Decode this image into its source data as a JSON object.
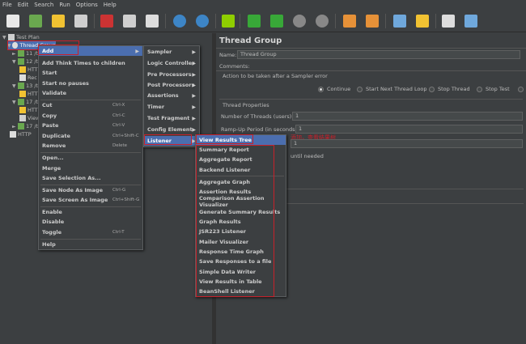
{
  "menubar": [
    "File",
    "Edit",
    "Search",
    "Run",
    "Options",
    "Help"
  ],
  "tree": {
    "test_plan": "Test Plan",
    "thread_group": "Thread Group",
    "items": [
      "11 /ti",
      "12 /ti",
      "HTT",
      "Rec",
      "13 /ti",
      "HTT",
      "17 /ti",
      "HTT",
      "View",
      "17 /ti",
      "HTTP"
    ]
  },
  "right_panel": {
    "title": "Thread Group",
    "name_label": "Name:",
    "name_value": "Thread Group",
    "comments_label": "Comments:",
    "error_section": "Action to be taken after a Sampler error",
    "error_options": [
      "Continue",
      "Start Next Thread Loop",
      "Stop Thread",
      "Stop Test",
      "S"
    ],
    "selected_error_option": "Continue",
    "thread_props": "Thread Properties",
    "threads_label": "Number of Threads (users):",
    "threads_value": "1",
    "rampup_label": "Ramp-Up Period (in seconds):",
    "rampup_value": "1",
    "loop_value": "1",
    "until_needed": "until needed",
    "chinese_note": "添加，查看结果树"
  },
  "context_menu": {
    "items": [
      {
        "label": "Add",
        "shortcut": ""
      },
      {
        "label": "Add Think Times to children",
        "shortcut": ""
      },
      {
        "label": "Start",
        "shortcut": ""
      },
      {
        "label": "Start no pauses",
        "shortcut": ""
      },
      {
        "label": "Validate",
        "shortcut": ""
      },
      {
        "label": "Cut",
        "shortcut": "Ctrl-X"
      },
      {
        "label": "Copy",
        "shortcut": "Ctrl-C"
      },
      {
        "label": "Paste",
        "shortcut": "Ctrl-V"
      },
      {
        "label": "Duplicate",
        "shortcut": "Ctrl+Shift-C"
      },
      {
        "label": "Remove",
        "shortcut": "Delete"
      },
      {
        "label": "Open...",
        "shortcut": ""
      },
      {
        "label": "Merge",
        "shortcut": ""
      },
      {
        "label": "Save Selection As...",
        "shortcut": ""
      },
      {
        "label": "Save Node As Image",
        "shortcut": "Ctrl-G"
      },
      {
        "label": "Save Screen As Image",
        "shortcut": "Ctrl+Shift-G"
      },
      {
        "label": "Enable",
        "shortcut": ""
      },
      {
        "label": "Disable",
        "shortcut": ""
      },
      {
        "label": "Toggle",
        "shortcut": "Ctrl-T"
      },
      {
        "label": "Help",
        "shortcut": ""
      }
    ]
  },
  "add_submenu": [
    "Sampler",
    "Logic Controller",
    "Pre Processors",
    "Post Processors",
    "Assertions",
    "Timer",
    "Test Fragment",
    "Config Element",
    "Listener"
  ],
  "listener_submenu": [
    "View Results Tree",
    "Summary Report",
    "Aggregate Report",
    "Backend Listener",
    "Aggregate Graph",
    "Assertion Results",
    "Comparison Assertion Visualizer",
    "Generate Summary Results",
    "Graph Results",
    "JSR223 Listener",
    "Mailer Visualizer",
    "Response Time Graph",
    "Save Responses to a file",
    "Simple Data Writer",
    "View Results in Table",
    "BeanShell Listener"
  ],
  "colors": {
    "background": "#3c3f41",
    "highlight": "#4b6eaf",
    "annotation_red": "#c8202a"
  }
}
